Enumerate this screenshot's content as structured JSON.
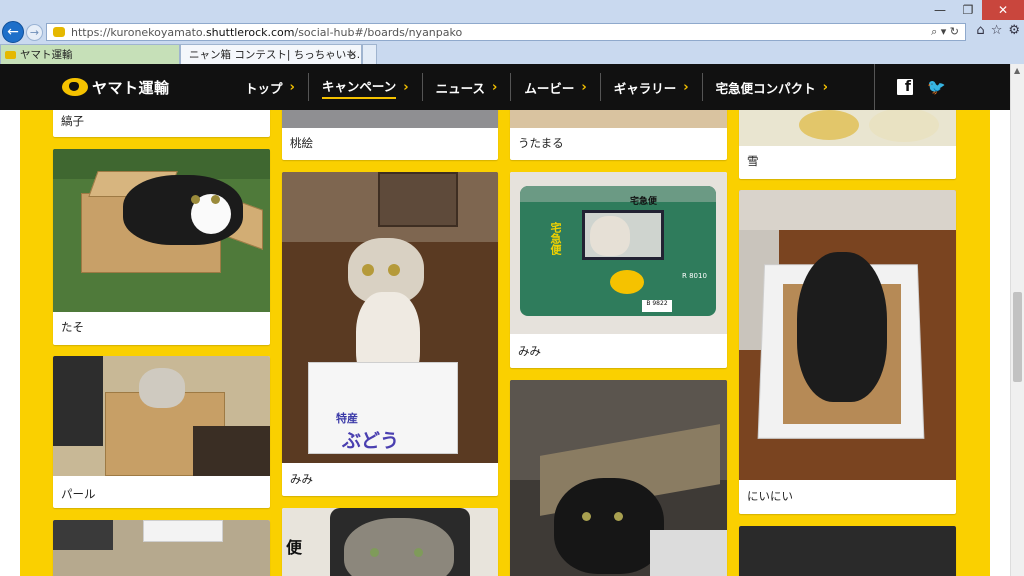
{
  "browser": {
    "url_prefix": "https://kuronekoyamato.",
    "url_domain": "shuttlerock.com",
    "url_suffix": "/social-hub#/boards/nyanpako",
    "tabs": [
      {
        "label": "ヤマト運輸",
        "active": false
      },
      {
        "label": "ニャン箱 コンテスト| ちっちゃいも...",
        "active": true
      }
    ],
    "tab_close": "×",
    "window_controls": {
      "minimize": "—",
      "restore": "❐",
      "close": "✕"
    },
    "address_tools": "⌕ ▾ ↻",
    "right_icons": [
      "⌂",
      "☆",
      "⚙"
    ]
  },
  "site": {
    "logo_text": "ヤマト運輸",
    "nav": [
      {
        "label": "トップ",
        "active": false
      },
      {
        "label": "キャンペーン",
        "active": true
      },
      {
        "label": "ニュース",
        "active": false
      },
      {
        "label": "ムービー",
        "active": false
      },
      {
        "label": "ギャラリー",
        "active": false
      },
      {
        "label": "宅急便コンパクト",
        "active": false
      }
    ],
    "chevron": "›",
    "social": {
      "facebook": "f",
      "twitter": "🐦"
    }
  },
  "gallery": {
    "captions": {
      "c1_top": "縞子",
      "c1_cat": "たそ",
      "c1_pearl": "パール",
      "c2_top": "桃絵",
      "c2_grape": "みみ",
      "c3_top": "うたまる",
      "c3_truck": "みみ",
      "c4_top": "雪",
      "c4_box": "にいにい"
    },
    "box_print": {
      "grape_line1": "特産",
      "grape_line2": "ぶどう",
      "truck_label": "宅急便",
      "truck_side": "宅急便",
      "truck_number": "R 8010",
      "truck_plate": "B 9822",
      "box_partial": "便"
    }
  },
  "colors": {
    "header_bg": "#111111",
    "accent_yellow": "#fad000",
    "chrome_bg": "#c9d9ef"
  }
}
